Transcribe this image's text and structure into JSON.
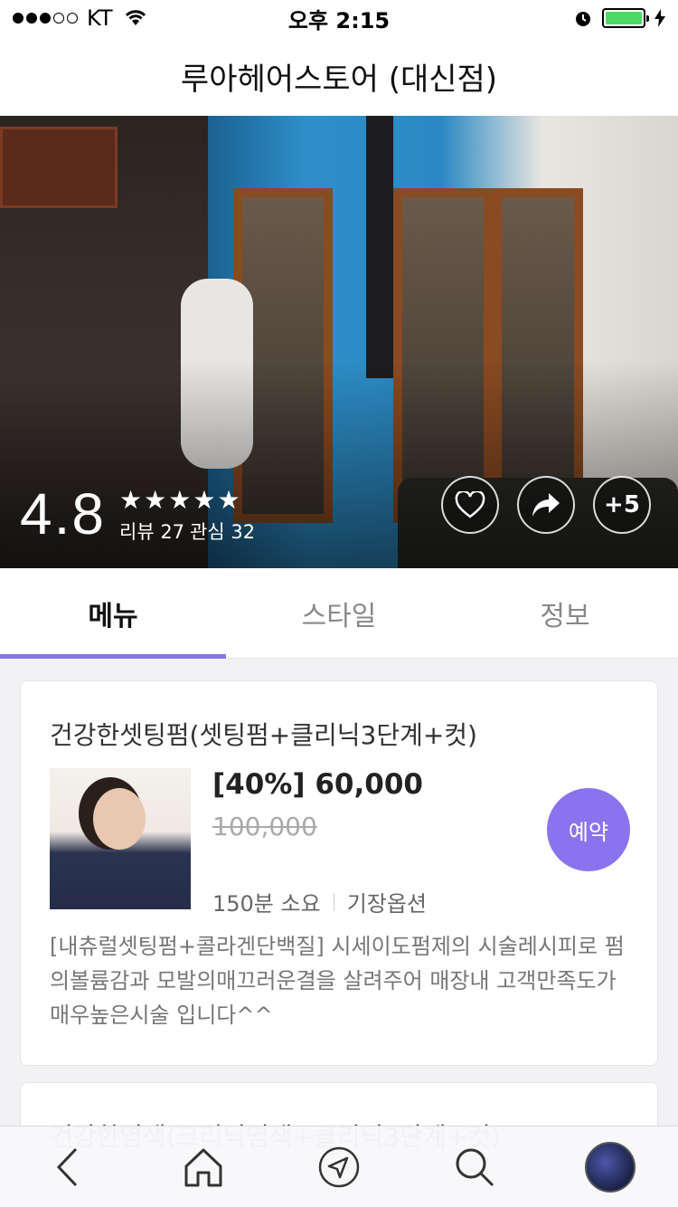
{
  "status_bar": {
    "carrier": "KT",
    "time": "오후 2:15",
    "battery_level": 1.0
  },
  "nav": {
    "title": "루아헤어스토어 (대신점)"
  },
  "hero": {
    "rating": "4.8",
    "stars": 5,
    "meta": [
      "리뷰 27",
      "관심 32"
    ],
    "more_label": "+5",
    "icons": [
      "heart-icon",
      "share-icon"
    ]
  },
  "tabs": [
    {
      "label": "메뉴",
      "active": true
    },
    {
      "label": "스타일",
      "active": false
    },
    {
      "label": "정보",
      "active": false
    }
  ],
  "menu_items": [
    {
      "title": "건강한셋팅펌(셋팅펌+클리닉3단계+컷)",
      "price": "[40%] 60,000",
      "original_price": "100,000",
      "duration": "150분 소요",
      "option": "기장옵션",
      "book_label": "예약",
      "description": "[내츄럴셋팅펌+콜라겐단백질] 시세이도펌제의 시술레시피로 펌의볼륨감과 모발의매끄러운결을 살려주어 매장내 고객만족도가 매우높은시술 입니다^^"
    },
    {
      "title": "건강한염색(크리닉염색+클리닉3단계+컷)"
    }
  ],
  "toolbar": {
    "items": [
      "back-icon",
      "home-icon",
      "location-icon",
      "search-icon",
      "profile-avatar"
    ]
  },
  "colors": {
    "accent": "#8c73ee",
    "tab_indicator": "#8a74e8"
  }
}
